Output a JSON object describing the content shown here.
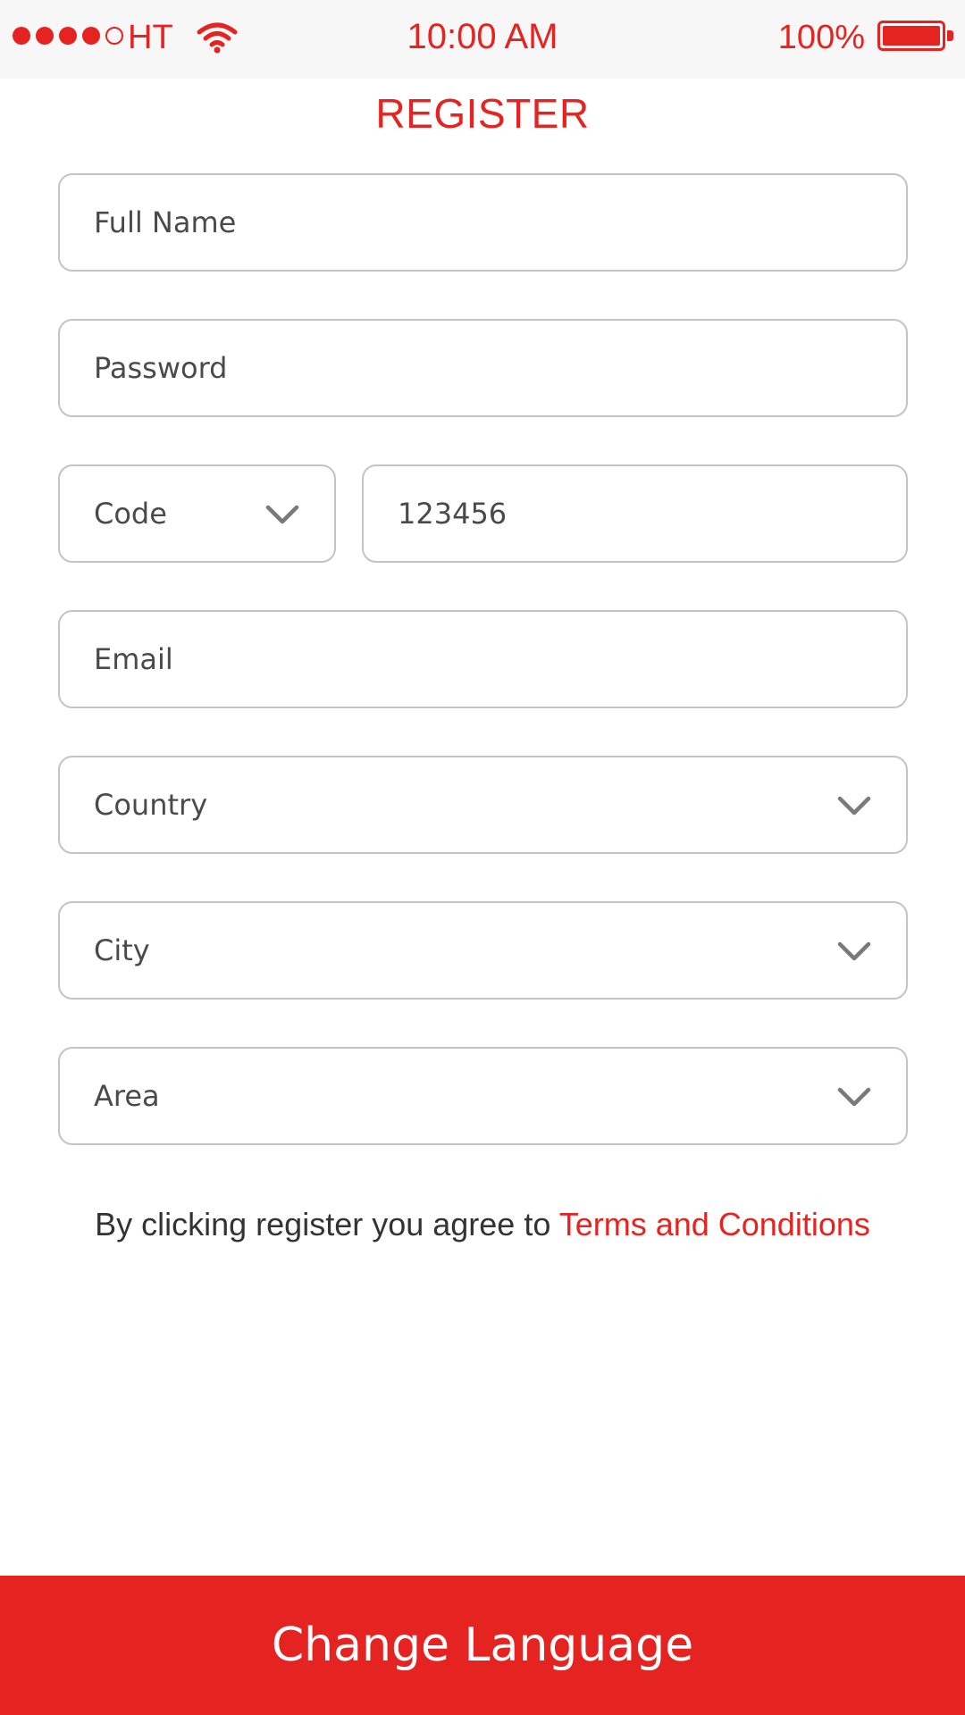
{
  "status_bar": {
    "carrier": "HT",
    "time": "10:00 AM",
    "battery_percent": "100%",
    "signal_bars_filled": 4,
    "signal_bars_total": 5,
    "accent_color": "#e52421"
  },
  "page": {
    "title": "REGISTER"
  },
  "form": {
    "full_name": {
      "placeholder": "Full Name",
      "value": ""
    },
    "password": {
      "placeholder": "Password",
      "value": ""
    },
    "code": {
      "label": "Code"
    },
    "phone": {
      "placeholder": "",
      "value": "123456"
    },
    "email": {
      "placeholder": "Email",
      "value": ""
    },
    "country": {
      "label": "Country"
    },
    "city": {
      "label": "City"
    },
    "area": {
      "label": "Area"
    }
  },
  "terms": {
    "prefix": "By clicking register you agree to ",
    "link_text": "Terms and Conditions"
  },
  "footer": {
    "button_label": "Change Language",
    "button_color": "#e52421"
  },
  "icons": {
    "chevron": "chevron-down-icon",
    "wifi": "wifi-icon",
    "battery": "battery-icon"
  }
}
